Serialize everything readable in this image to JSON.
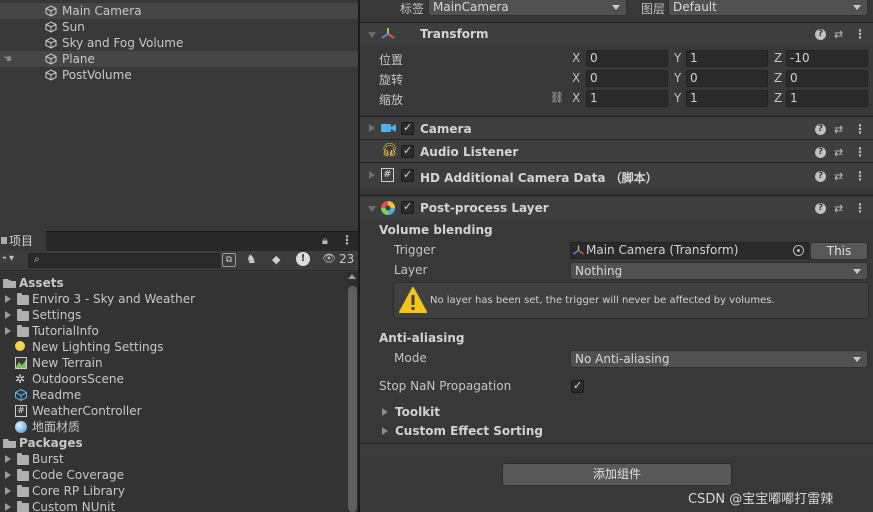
{
  "hierarchy": {
    "items": [
      {
        "label": "Main Camera"
      },
      {
        "label": "Sun"
      },
      {
        "label": "Sky and Fog Volume"
      },
      {
        "label": "Plane"
      },
      {
        "label": "PostVolume"
      }
    ]
  },
  "project": {
    "tab_label": "项目",
    "hidden_count": "23",
    "tree": [
      {
        "label": "Assets",
        "kind": "root",
        "expanded": true
      },
      {
        "label": "Enviro 3 - Sky and Weather",
        "kind": "folder"
      },
      {
        "label": "Settings",
        "kind": "folder"
      },
      {
        "label": "TutorialInfo",
        "kind": "folder"
      },
      {
        "label": "New Lighting Settings",
        "kind": "lighting"
      },
      {
        "label": "New Terrain",
        "kind": "terrain"
      },
      {
        "label": "OutdoorsScene",
        "kind": "scene"
      },
      {
        "label": "Readme",
        "kind": "asset"
      },
      {
        "label": "WeatherController",
        "kind": "script"
      },
      {
        "label": "地面材质",
        "kind": "material"
      },
      {
        "label": "Packages",
        "kind": "root",
        "expanded": true
      },
      {
        "label": "Burst",
        "kind": "folder"
      },
      {
        "label": "Code Coverage",
        "kind": "folder"
      },
      {
        "label": "Core RP Library",
        "kind": "folder"
      },
      {
        "label": "Custom NUnit",
        "kind": "folder"
      }
    ]
  },
  "inspector": {
    "tag_label": "标签",
    "tag_value": "MainCamera",
    "layer_label": "图层",
    "layer_value": "Default",
    "transform": {
      "title": "Transform",
      "position_label": "位置",
      "rotation_label": "旋转",
      "scale_label": "缩放",
      "axes": [
        "X",
        "Y",
        "Z"
      ],
      "position": [
        "0",
        "1",
        "-10"
      ],
      "rotation": [
        "0",
        "0",
        "0"
      ],
      "scale": [
        "1",
        "1",
        "1"
      ]
    },
    "camera_title": "Camera",
    "audio_listener_title": "Audio Listener",
    "hd_camera_title": "HD Additional Camera Data （脚本）",
    "post_process": {
      "title": "Post-process Layer",
      "volume_blending": "Volume blending",
      "trigger_label": "Trigger",
      "trigger_value": "Main Camera (Transform)",
      "this_button": "This",
      "layer_label": "Layer",
      "layer_value": "Nothing",
      "warning": "No layer has been set, the trigger will never be affected by volumes.",
      "anti_aliasing": "Anti-aliasing",
      "mode_label": "Mode",
      "mode_value": "No Anti-aliasing",
      "stop_nan_label": "Stop NaN Propagation",
      "stop_nan_checked": true,
      "toolkit": "Toolkit",
      "custom_effect_sorting": "Custom Effect Sorting"
    },
    "add_component": "添加组件"
  },
  "watermark": "CSDN @宝宝嘟嘟打雷辣",
  "colors": {
    "panel_bg": "#383838",
    "field_bg": "#2a2a2a",
    "warning_yellow": "#f5c518",
    "selection": "#464646"
  }
}
